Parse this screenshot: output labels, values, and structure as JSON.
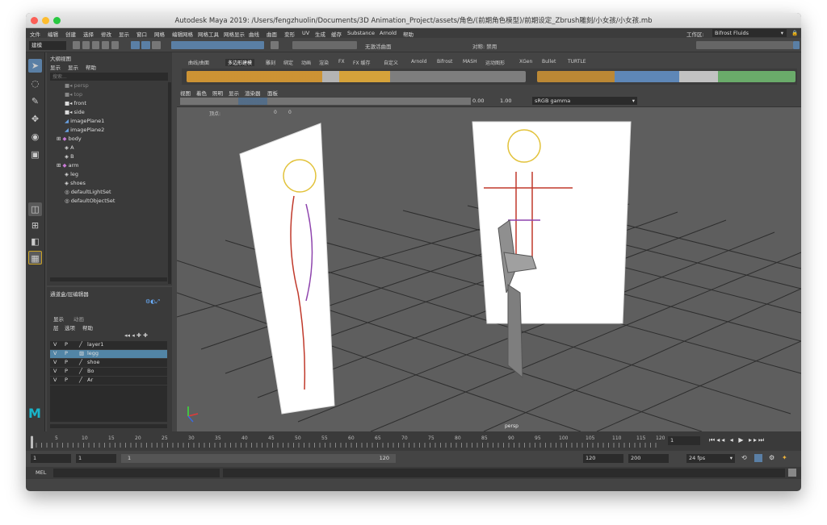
{
  "window": {
    "title": "Autodesk Maya 2019: /Users/fengzhuolin/Documents/3D Animation_Project/assets/角色/(前期角色模型)/前期设定_Zbrush雕刻/小女孩/小女孩.mb"
  },
  "menubar": {
    "items": [
      "文件",
      "编辑",
      "创建",
      "选择",
      "修改",
      "显示",
      "窗口",
      "网格",
      "编辑网格",
      "网格工具",
      "网格显示",
      "曲线",
      "曲面",
      "变形",
      "UV",
      "生成",
      "缓存",
      "Substance",
      "Arnold",
      "帮助"
    ],
    "workspace_label": "工作区:",
    "workspace_value": "Bifrost Fluids"
  },
  "statusline": {
    "mode": "建模",
    "no_live": "无激活曲面",
    "symmetry": "对称: 禁用"
  },
  "shelf": {
    "tabs": [
      "曲线/曲面",
      "多边形建模",
      "雕刻",
      "绑定",
      "动画",
      "渲染",
      "FX",
      "FX 缓存",
      "自定义",
      "Arnold",
      "Bifrost",
      "MASH",
      "运动图形",
      "XGen",
      "Bullet",
      "TURTLE"
    ],
    "active_tab": "多边形建模"
  },
  "outliner": {
    "title": "大纲视图",
    "menu": [
      "显示",
      "显示",
      "帮助"
    ],
    "search_placeholder": "搜索...",
    "items": [
      {
        "label": "persp",
        "indent": 1,
        "dim": true,
        "icon": "camera-icon"
      },
      {
        "label": "top",
        "indent": 1,
        "dim": true,
        "icon": "camera-icon"
      },
      {
        "label": "front",
        "indent": 1,
        "dim": false,
        "icon": "camera-icon"
      },
      {
        "label": "side",
        "indent": 1,
        "dim": false,
        "icon": "camera-icon"
      },
      {
        "label": "imagePlane1",
        "indent": 1,
        "dim": false,
        "icon": "image-plane-icon"
      },
      {
        "label": "imagePlane2",
        "indent": 1,
        "dim": false,
        "icon": "image-plane-icon"
      },
      {
        "label": "body",
        "indent": 0,
        "dim": false,
        "icon": "group-icon"
      },
      {
        "label": "A",
        "indent": 1,
        "dim": false,
        "icon": "mesh-icon"
      },
      {
        "label": "B",
        "indent": 1,
        "dim": false,
        "icon": "mesh-icon"
      },
      {
        "label": "arm",
        "indent": 0,
        "dim": false,
        "icon": "group-icon"
      },
      {
        "label": "leg",
        "indent": 1,
        "dim": false,
        "icon": "mesh-icon"
      },
      {
        "label": "shoes",
        "indent": 1,
        "dim": false,
        "icon": "mesh-icon"
      },
      {
        "label": "defaultLightSet",
        "indent": 1,
        "dim": false,
        "icon": "set-icon"
      },
      {
        "label": "defaultObjectSet",
        "indent": 1,
        "dim": false,
        "icon": "set-icon"
      }
    ]
  },
  "channelbox": {
    "title": "通道盒/层编辑器",
    "tabs": [
      "显示",
      "动画"
    ],
    "menu": [
      "层",
      "选项",
      "帮助"
    ],
    "layers": [
      {
        "v": "V",
        "p": "P",
        "name": "layer1",
        "selected": false
      },
      {
        "v": "V",
        "p": "P",
        "name": "legg",
        "selected": true
      },
      {
        "v": "V",
        "p": "P",
        "name": "shoe",
        "selected": false
      },
      {
        "v": "V",
        "p": "P",
        "name": "Bo",
        "selected": false
      },
      {
        "v": "V",
        "p": "P",
        "name": "Ar",
        "selected": false
      }
    ]
  },
  "viewport": {
    "menu": [
      "视图",
      "着色",
      "照明",
      "显示",
      "渲染器",
      "面板"
    ],
    "exposure": "0.00",
    "gamma": "1.00",
    "colorspace": "sRGB gamma",
    "hud_label": "顶点:",
    "hud_v1": "0",
    "hud_v2": "0",
    "camera_label": "persp"
  },
  "timeline": {
    "ticks": [
      "1",
      "5",
      "10",
      "15",
      "20",
      "25",
      "30",
      "35",
      "40",
      "45",
      "50",
      "55",
      "60",
      "65",
      "70",
      "75",
      "80",
      "85",
      "90",
      "95",
      "100",
      "105",
      "110",
      "115",
      "120"
    ],
    "current_frame": "1"
  },
  "range": {
    "start": "1",
    "playback_start": "1",
    "slider_start": "1",
    "slider_end": "120",
    "playback_end": "120",
    "end": "200",
    "fps": "24 fps"
  },
  "mel": {
    "label": "MEL"
  }
}
